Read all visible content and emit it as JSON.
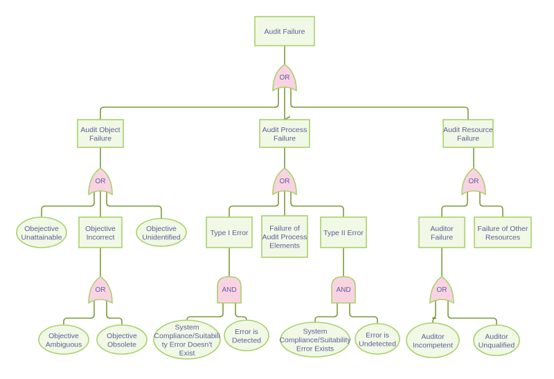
{
  "diagram": {
    "type": "fault-tree",
    "colors": {
      "connector": "#7a9a3a",
      "node_fill": "#f1f8e6",
      "node_border": "#a8d06a",
      "gate_fill": "#fad3e3",
      "text": "#5a5f96"
    },
    "nodes": {
      "audit_failure": {
        "label": [
          "Audit Failure"
        ],
        "shape": "rect"
      },
      "audit_object_failure": {
        "label": [
          "Audit Object",
          "Failure"
        ],
        "shape": "rect"
      },
      "audit_process_failure": {
        "label": [
          "Audit Process",
          "Failure"
        ],
        "shape": "rect"
      },
      "audit_resource_failure": {
        "label": [
          "Audit Resource",
          "Failure"
        ],
        "shape": "rect"
      },
      "objective_unattainable": {
        "label": [
          "Obejective",
          "Unattainable"
        ],
        "shape": "ellipse"
      },
      "objective_incorrect": {
        "label": [
          "Objective",
          "Incorrect"
        ],
        "shape": "rect"
      },
      "objective_unidentified": {
        "label": [
          "Objective",
          "Unidentified"
        ],
        "shape": "ellipse"
      },
      "objective_ambiguous": {
        "label": [
          "Objective",
          "Ambiguous"
        ],
        "shape": "ellipse"
      },
      "objective_obsolete": {
        "label": [
          "Objective",
          "Obsolete"
        ],
        "shape": "ellipse"
      },
      "type_i_error": {
        "label": [
          "Type I Error"
        ],
        "shape": "rect"
      },
      "failure_process_elements": {
        "label": [
          "Failure of",
          "Audit Process",
          "Elements"
        ],
        "shape": "rect"
      },
      "type_ii_error": {
        "label": [
          "Type II Error"
        ],
        "shape": "rect"
      },
      "compliance_doesnt_exist": {
        "label": [
          "System",
          "Compliance/Suitabili",
          "ty Error Doesn't",
          "Exist"
        ],
        "shape": "ellipse"
      },
      "error_detected": {
        "label": [
          "Error is",
          "Detected"
        ],
        "shape": "ellipse"
      },
      "compliance_exists": {
        "label": [
          "System",
          "Compliance/Suitability",
          "Error Exists"
        ],
        "shape": "ellipse"
      },
      "error_undetected": {
        "label": [
          "Error is",
          "Undetected"
        ],
        "shape": "ellipse"
      },
      "auditor_failure": {
        "label": [
          "Auditor",
          "Failure"
        ],
        "shape": "rect"
      },
      "failure_other_resources": {
        "label": [
          "Failure of Other",
          "Resources"
        ],
        "shape": "rect"
      },
      "auditor_incompetent": {
        "label": [
          "Auditor",
          "Incompetent"
        ],
        "shape": "ellipse"
      },
      "auditor_unqualified": {
        "label": [
          "Auditor",
          "Unqualified"
        ],
        "shape": "ellipse"
      }
    },
    "gates": {
      "g_top": {
        "type": "OR",
        "label": "OR",
        "output": "audit_failure",
        "inputs": [
          "audit_object_failure",
          "audit_process_failure",
          "audit_resource_failure"
        ]
      },
      "g_object": {
        "type": "OR",
        "label": "OR",
        "output": "audit_object_failure",
        "inputs": [
          "objective_unattainable",
          "objective_incorrect",
          "objective_unidentified"
        ]
      },
      "g_process": {
        "type": "OR",
        "label": "OR",
        "output": "audit_process_failure",
        "inputs": [
          "type_i_error",
          "failure_process_elements",
          "type_ii_error"
        ]
      },
      "g_resource": {
        "type": "OR",
        "label": "OR",
        "output": "audit_resource_failure",
        "inputs": [
          "auditor_failure",
          "failure_other_resources"
        ]
      },
      "g_incorrect": {
        "type": "OR",
        "label": "OR",
        "output": "objective_incorrect",
        "inputs": [
          "objective_ambiguous",
          "objective_obsolete"
        ]
      },
      "g_type1": {
        "type": "AND",
        "label": "AND",
        "output": "type_i_error",
        "inputs": [
          "compliance_doesnt_exist",
          "error_detected"
        ]
      },
      "g_type2": {
        "type": "AND",
        "label": "AND",
        "output": "type_ii_error",
        "inputs": [
          "compliance_exists",
          "error_undetected"
        ]
      },
      "g_auditor": {
        "type": "OR",
        "label": "OR",
        "output": "auditor_failure",
        "inputs": [
          "auditor_incompetent",
          "auditor_unqualified"
        ]
      }
    }
  }
}
